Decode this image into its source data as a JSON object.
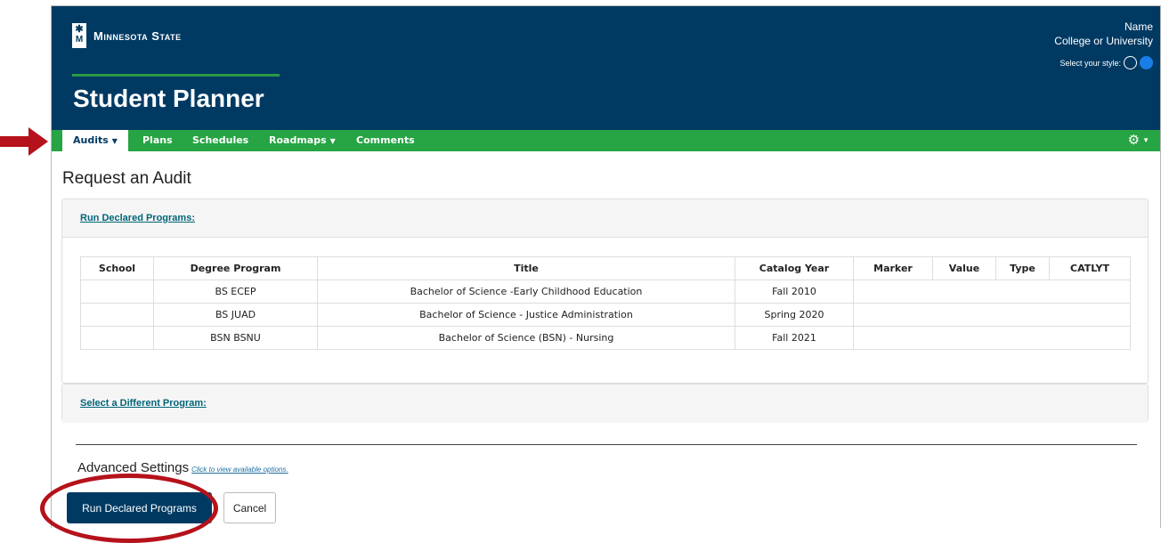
{
  "header": {
    "logo_text": "Minnesota State",
    "app_title": "Student Planner",
    "user_name": "Name",
    "institution": "College or University",
    "style_label": "Select your style:"
  },
  "nav": {
    "items": [
      {
        "label": "Audits",
        "dropdown": true,
        "active": true
      },
      {
        "label": "Plans",
        "dropdown": false
      },
      {
        "label": "Schedules",
        "dropdown": false
      },
      {
        "label": "Roadmaps",
        "dropdown": true
      },
      {
        "label": "Comments",
        "dropdown": false
      }
    ],
    "settings_icon": "gear-icon"
  },
  "page": {
    "title": "Request an Audit",
    "declared_link": "Run Declared Programs:",
    "different_link": "Select a Different Program:"
  },
  "table": {
    "headers": [
      "School",
      "Degree Program",
      "Title",
      "Catalog Year",
      "Marker",
      "Value",
      "Type",
      "CATLYT"
    ],
    "rows": [
      [
        "",
        "BS ECEP",
        "Bachelor of Science -Early Childhood Education",
        "Fall 2010",
        "",
        "",
        "",
        ""
      ],
      [
        "",
        "BS JUAD",
        "Bachelor of Science - Justice Administration",
        "Spring 2020",
        "",
        "",
        "",
        ""
      ],
      [
        "",
        "BSN BSNU",
        "Bachelor of Science (BSN) - Nursing",
        "Fall 2021",
        "",
        "",
        "",
        ""
      ]
    ]
  },
  "advanced": {
    "label": "Advanced Settings",
    "link": "Click to view available options."
  },
  "buttons": {
    "run": "Run Declared Programs",
    "cancel": "Cancel"
  },
  "colors": {
    "header_bg": "#003a63",
    "nav_bg": "#27a443",
    "annotation_red": "#b5121b"
  }
}
